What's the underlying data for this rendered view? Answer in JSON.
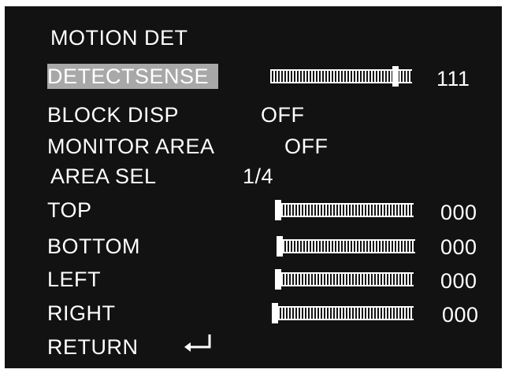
{
  "menu": {
    "title": "MOTION DET",
    "detectsense": {
      "label": "DETECTSENSE",
      "value": "111",
      "level": 0.9
    },
    "block_disp": {
      "label": "BLOCK DISP",
      "value": "OFF"
    },
    "monitor_area": {
      "label": "MONITOR AREA",
      "value": "OFF"
    },
    "area_sel": {
      "label": "AREA SEL",
      "value": "1/4"
    },
    "top": {
      "label": "TOP",
      "value": "000",
      "level": 0.0
    },
    "bottom": {
      "label": "BOTTOM",
      "value": "000",
      "level": 0.0
    },
    "left": {
      "label": "LEFT",
      "value": "000",
      "level": 0.0
    },
    "right": {
      "label": "RIGHT",
      "value": "000",
      "level": 0.0
    },
    "return": {
      "label": "RETURN",
      "icon": "return-arrow-icon"
    }
  },
  "colors": {
    "background": "#121212",
    "text": "#ffffff",
    "highlight": "#a8a8a8"
  }
}
